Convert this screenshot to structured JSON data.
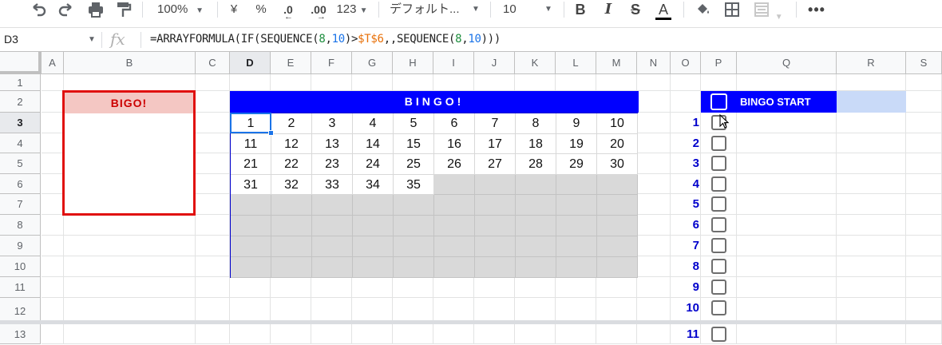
{
  "toolbar": {
    "zoom": "100%",
    "currency": "¥",
    "percent": "%",
    "dec_less": ".0",
    "dec_more": ".00",
    "format_more": "123",
    "font_name": "デフォルト...",
    "font_size": "10",
    "bold": "B",
    "italic": "I",
    "strike": "S",
    "text_color": "A"
  },
  "formula_bar": {
    "cell_ref": "D3",
    "fx": "fx",
    "formula_parts": [
      "=ARRAYFORMULA(IF(SEQUENCE(",
      "8",
      ",",
      "10",
      ")>",
      "$T$6",
      ",,SEQUENCE(",
      "8",
      ",",
      "10",
      ")))"
    ]
  },
  "columns": [
    "A",
    "B",
    "C",
    "D",
    "E",
    "F",
    "G",
    "H",
    "I",
    "J",
    "K",
    "L",
    "M",
    "N",
    "O",
    "P",
    "Q",
    "R",
    "S"
  ],
  "rows": [
    "1",
    "2",
    "3",
    "4",
    "5",
    "6",
    "7",
    "8",
    "9",
    "10",
    "11",
    "12",
    "13"
  ],
  "selected_cell": "D3",
  "bigo": {
    "title": "BIGO!"
  },
  "bingo": {
    "title": "BINGO!",
    "numbers": [
      [
        "1",
        "2",
        "3",
        "4",
        "5",
        "6",
        "7",
        "8",
        "9",
        "10"
      ],
      [
        "11",
        "12",
        "13",
        "14",
        "15",
        "16",
        "17",
        "18",
        "19",
        "20"
      ],
      [
        "21",
        "22",
        "23",
        "24",
        "25",
        "26",
        "27",
        "28",
        "29",
        "30"
      ],
      [
        "31",
        "32",
        "33",
        "34",
        "35",
        "",
        "",
        "",
        "",
        ""
      ],
      [
        "",
        "",
        "",
        "",
        "",
        "",
        "",
        "",
        "",
        ""
      ],
      [
        "",
        "",
        "",
        "",
        "",
        "",
        "",
        "",
        "",
        ""
      ],
      [
        "",
        "",
        "",
        "",
        "",
        "",
        "",
        "",
        "",
        ""
      ],
      [
        "",
        "",
        "",
        "",
        "",
        "",
        "",
        "",
        "",
        ""
      ]
    ]
  },
  "start": {
    "label": "BINGO START"
  },
  "draws": [
    "1",
    "2",
    "3",
    "4",
    "5",
    "6",
    "7",
    "8",
    "9",
    "10",
    "11"
  ],
  "colors": {
    "header_blue": "#0000ff",
    "bigo_red": "#e0100e",
    "bigo_fill": "#f4c7c3",
    "unfilled_gray": "#d9d9d9",
    "selection": "#1a73e8"
  }
}
